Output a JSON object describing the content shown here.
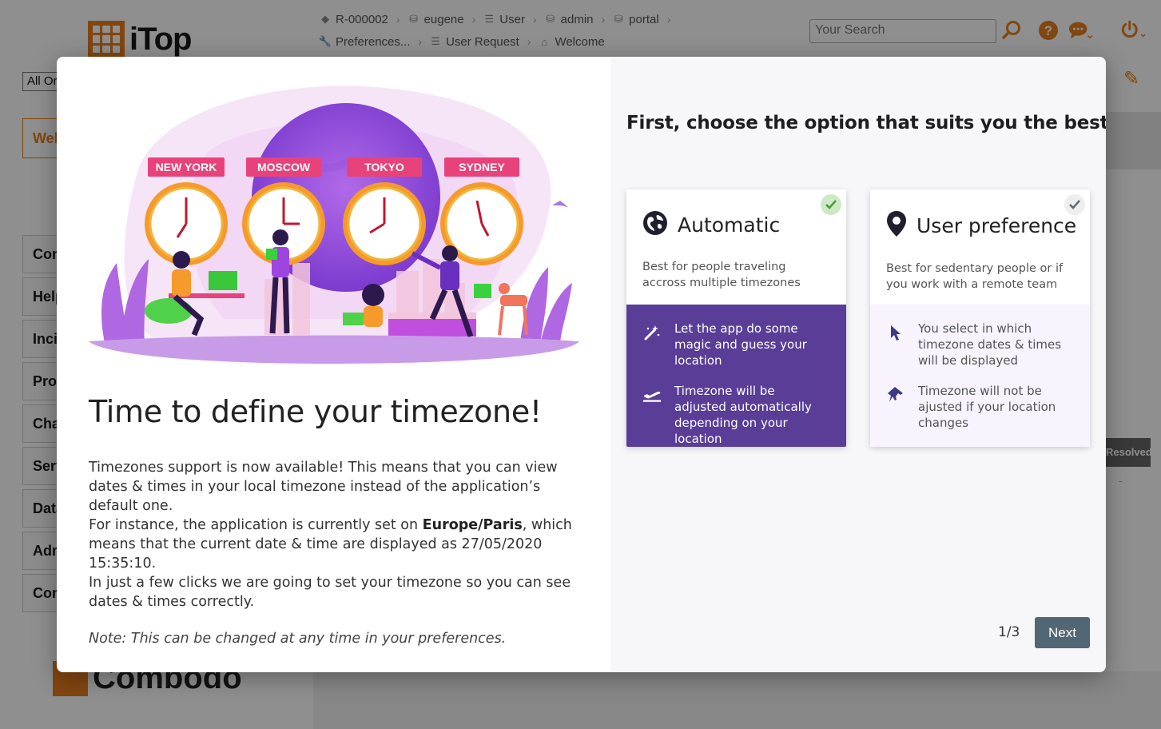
{
  "background": {
    "logo_text": "iTop",
    "breadcrumbs_row1": [
      "R-000002",
      "eugene",
      "User",
      "admin",
      "portal"
    ],
    "breadcrumbs_row2": [
      "Preferences...",
      "User Request",
      "Welcome"
    ],
    "search_placeholder": "Your Search",
    "org_select_value": "All Organizations",
    "menu_first": "Welcome",
    "menu_groups": [
      "Configuration Management",
      "Helpdesk",
      "Incident Management",
      "Problem Management",
      "Change Management",
      "Service Management",
      "Data Model",
      "Admin Tools",
      "Configuration"
    ],
    "resolved_label": "Resolved",
    "resolved_value": "-",
    "footer_brand": "Combodo"
  },
  "modal": {
    "illustration_cities": [
      "NEW YORK",
      "MOSCOW",
      "TOKYO",
      "SYDNEY"
    ],
    "title": "Time to define your timezone!",
    "paragraph1": "Timezones support is now available! This means that you can view dates & times in your local timezone instead of the application’s default one.",
    "paragraph2_pre": "For instance, the application is currently set on ",
    "paragraph2_tz": "Europe/Paris",
    "paragraph2_post": ", which means that the current date & time are displayed as 27/05/2020 15:35:10.",
    "paragraph3": "In just a few clicks we are going to set your timezone so you can see dates & times correctly.",
    "note": "Note: This can be changed at any time in your preferences.",
    "right_heading": "First, choose the option that suits you the best",
    "options": [
      {
        "title": "Automatic",
        "description": "Best for people traveling accross multiple timezones",
        "selected": true,
        "features": [
          "Let the app do some magic and guess your location",
          "Timezone will be adjusted automatically depending on your location"
        ]
      },
      {
        "title": "User preference",
        "description": "Best for sedentary people or if you work with a remote team",
        "selected": false,
        "features": [
          "You select in which timezone dates & times will be displayed",
          "Timezone will not be ajusted if your location changes"
        ]
      }
    ],
    "pager": "1/3",
    "next_label": "Next"
  },
  "colors": {
    "brand_orange": "#e87d1e",
    "auto_purple": "#5a3d96",
    "next_button": "#526773",
    "check_green": "#6bb35a"
  }
}
